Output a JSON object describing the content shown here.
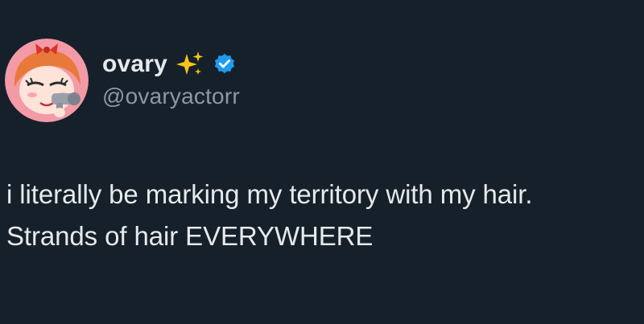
{
  "tweet": {
    "author": {
      "display_name": "ovary",
      "handle": "@ovaryactorr",
      "name_emoji_icon": "sparkles-icon",
      "verified_icon": "verified-badge-icon",
      "avatar_icon": "cartoon-avatar"
    },
    "text_lines": [
      "i literally be marking my territory with my hair.",
      "Strands of hair EVERYWHERE"
    ]
  },
  "colors": {
    "background": "#15202b",
    "primary_text": "#e7e9ea",
    "secondary_text": "#8b98a5",
    "verified_blue": "#1d9bf0",
    "sparkle_gold": "#f5c518"
  }
}
